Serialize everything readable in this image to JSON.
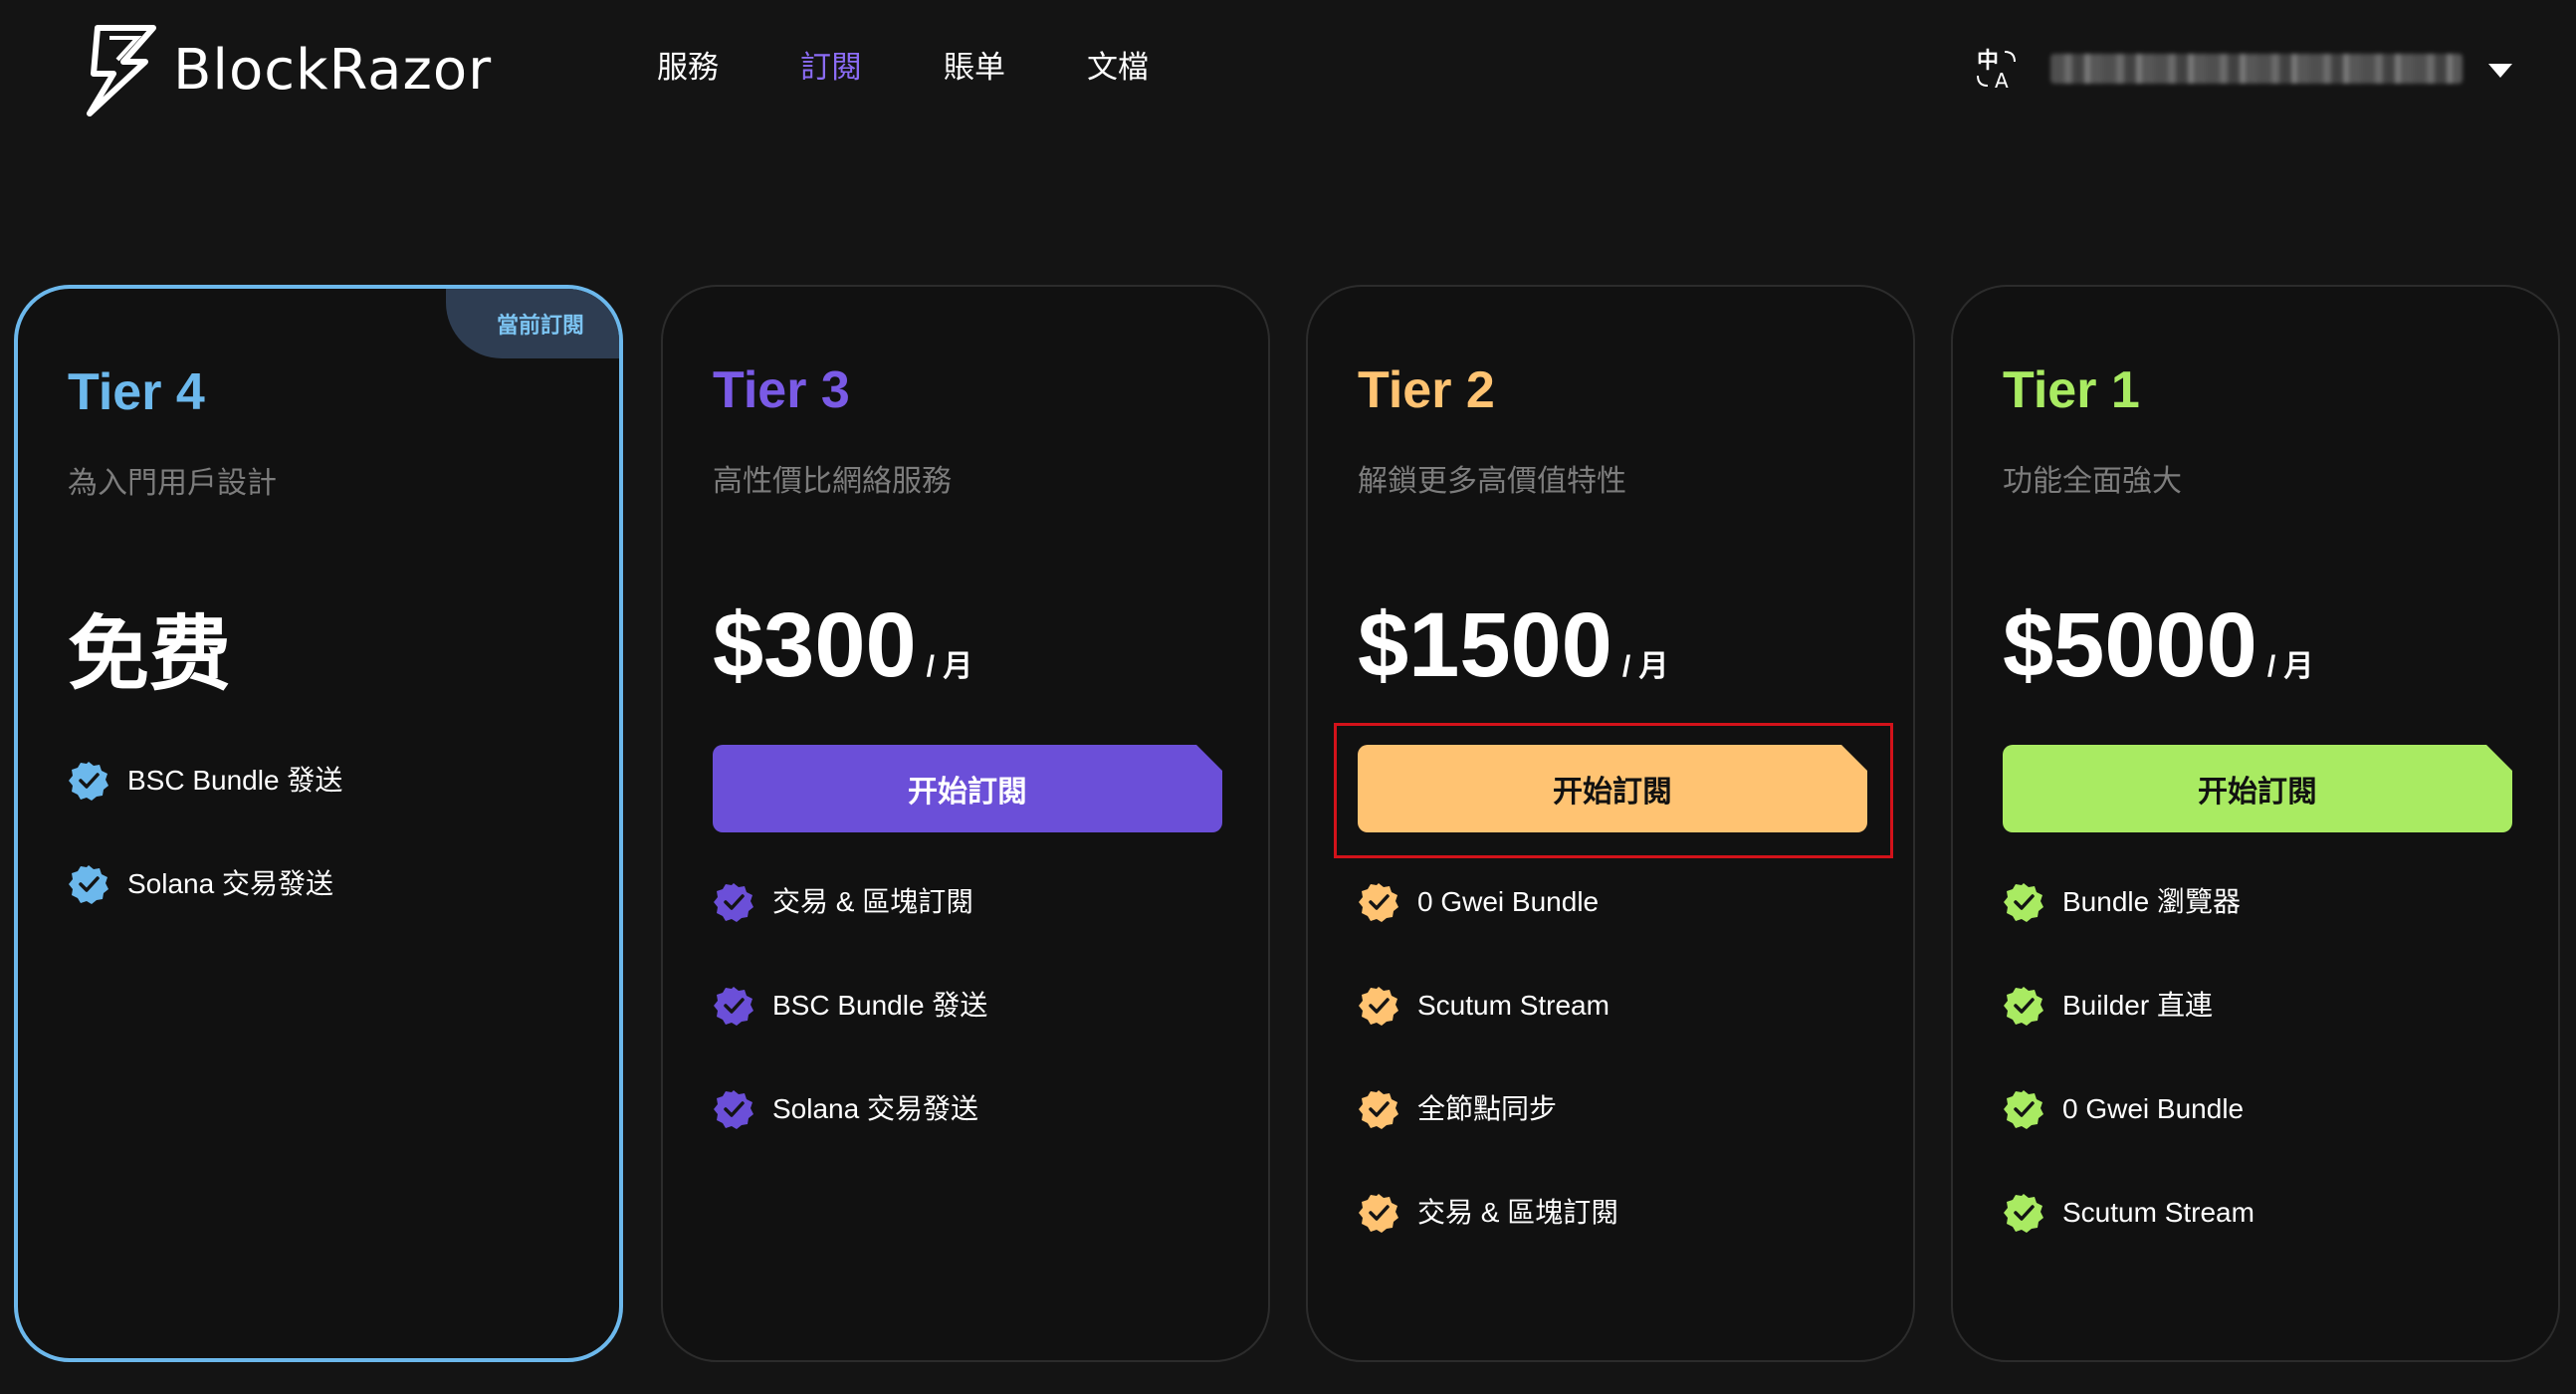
{
  "header": {
    "brand": "BlockRazor",
    "nav": [
      {
        "label": "服務",
        "active": false
      },
      {
        "label": "訂閱",
        "active": true
      },
      {
        "label": "賬单",
        "active": false
      },
      {
        "label": "文檔",
        "active": false
      }
    ],
    "lang_icon": "translate-icon",
    "user_email": "",
    "dropdown_icon": "caret-down-icon"
  },
  "colors": {
    "background": "#141414",
    "nav_active": "#8b6cf5",
    "tier4": "#6cb8ec",
    "tier3": "#6b4fd8",
    "tier2": "#ffc372",
    "tier1": "#a9eb62"
  },
  "plans": [
    {
      "name": "Tier 4",
      "desc": "為入門用戶設計",
      "price": "免费",
      "unit": "",
      "current": true,
      "badge": "當前訂閱",
      "features": [
        "BSC Bundle 發送",
        "Solana 交易發送"
      ]
    },
    {
      "name": "Tier 3",
      "desc": "高性價比網絡服務",
      "price": "$300",
      "unit": "/ 月",
      "cta": "开始訂閱",
      "features": [
        "交易 & 區塊訂閱",
        "BSC Bundle 發送",
        "Solana 交易發送"
      ]
    },
    {
      "name": "Tier 2",
      "desc": "解鎖更多高價值特性",
      "price": "$1500",
      "unit": "/ 月",
      "cta": "开始訂閱",
      "highlighted": true,
      "features": [
        "0 Gwei Bundle",
        "Scutum Stream",
        "全節點同步",
        "交易 & 區塊訂閱"
      ]
    },
    {
      "name": "Tier 1",
      "desc": "功能全面強大",
      "price": "$5000",
      "unit": "/ 月",
      "cta": "开始訂閱",
      "features": [
        "Bundle 瀏覽器",
        "Builder 直連",
        "0 Gwei Bundle",
        "Scutum Stream"
      ]
    }
  ]
}
